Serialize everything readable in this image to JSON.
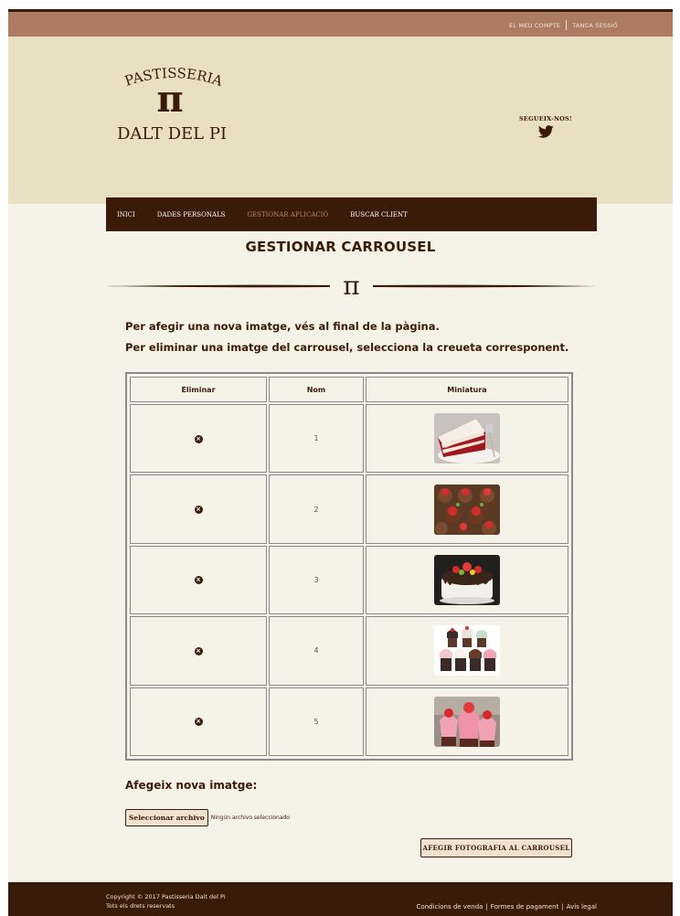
{
  "topbar": {
    "account_link": "EL MEU COMPTE",
    "logout_link": "TANCA SESSIÓ"
  },
  "logo": {
    "line1": "PASTISSERIA",
    "symbol": "π",
    "line2": "DALT DEL PI"
  },
  "social": {
    "follow_label": "SEGUEIX-NOS!",
    "icon": "twitter-icon"
  },
  "nav": {
    "items": [
      {
        "label": "INICI",
        "active": false
      },
      {
        "label": "DADES PERSONALS",
        "active": false
      },
      {
        "label": "GESTIONAR APLICACIÓ",
        "active": true
      },
      {
        "label": "BUSCAR CLIENT",
        "active": false
      }
    ]
  },
  "main": {
    "title": "GESTIONAR CARROUSEL",
    "divider_symbol": "π",
    "instruction_1": "Per afegir una nova imatge, vés al final de la pàgina.",
    "instruction_2": "Per eliminar una imatge del carrousel, selecciona la creueta corresponent."
  },
  "table": {
    "headers": [
      "Eliminar",
      "Nom",
      "Miniatura"
    ],
    "rows": [
      {
        "name": "1",
        "thumbnail": "red-velvet-cake-slice"
      },
      {
        "name": "2",
        "thumbnail": "chocolate-strawberry-cupcakes"
      },
      {
        "name": "3",
        "thumbnail": "chocolate-drip-fruit-cake"
      },
      {
        "name": "4",
        "thumbnail": "assorted-cupcakes"
      },
      {
        "name": "5",
        "thumbnail": "strawberry-cupcakes"
      }
    ]
  },
  "upload": {
    "title": "Afegeix nova imatge:",
    "file_button": "Seleccionar archivo",
    "file_status": "Ningún archivo seleccionado",
    "submit_button": "AFEGIR FOTOGRAFIA AL CARROUSEL"
  },
  "footer": {
    "copyright": "Copyright © 2017 Pastisseria Dalt del Pi",
    "rights": "Tots els drets reservats",
    "links": [
      "Condicions de venda",
      "Formes de pagament",
      "Avís legal"
    ]
  },
  "colors": {
    "dark_brown": "#3a1a08",
    "topbar": "#ad7a62",
    "header_bg": "#e9dfc3",
    "content_bg": "#f5f3e8",
    "nav_active": "#b8866a"
  }
}
